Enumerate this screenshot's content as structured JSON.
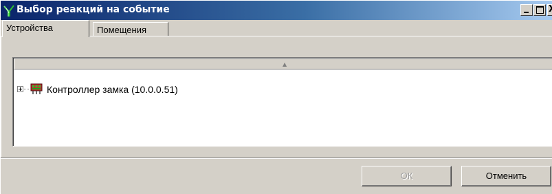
{
  "window": {
    "title": "Выбор реакций на событие",
    "icon": "app-icon",
    "controls": {
      "minimize": "minimize",
      "maximize": "maximize",
      "close": "X"
    }
  },
  "tabs": [
    {
      "label": "Устройства",
      "active": true
    },
    {
      "label": "Помещения",
      "active": false
    }
  ],
  "tree": {
    "column_header": {
      "sort_indicator": "▲"
    },
    "items": [
      {
        "label": "Контроллер замка (10.0.0.51)",
        "expanded": false,
        "icon": "controller-device-icon"
      }
    ]
  },
  "buttons": {
    "ok_label": "ОК",
    "ok_enabled": false,
    "cancel_label": "Отменить"
  },
  "colors": {
    "titlebar_start": "#0a246a",
    "titlebar_end": "#a6caf0",
    "face": "#d4d0c8"
  }
}
